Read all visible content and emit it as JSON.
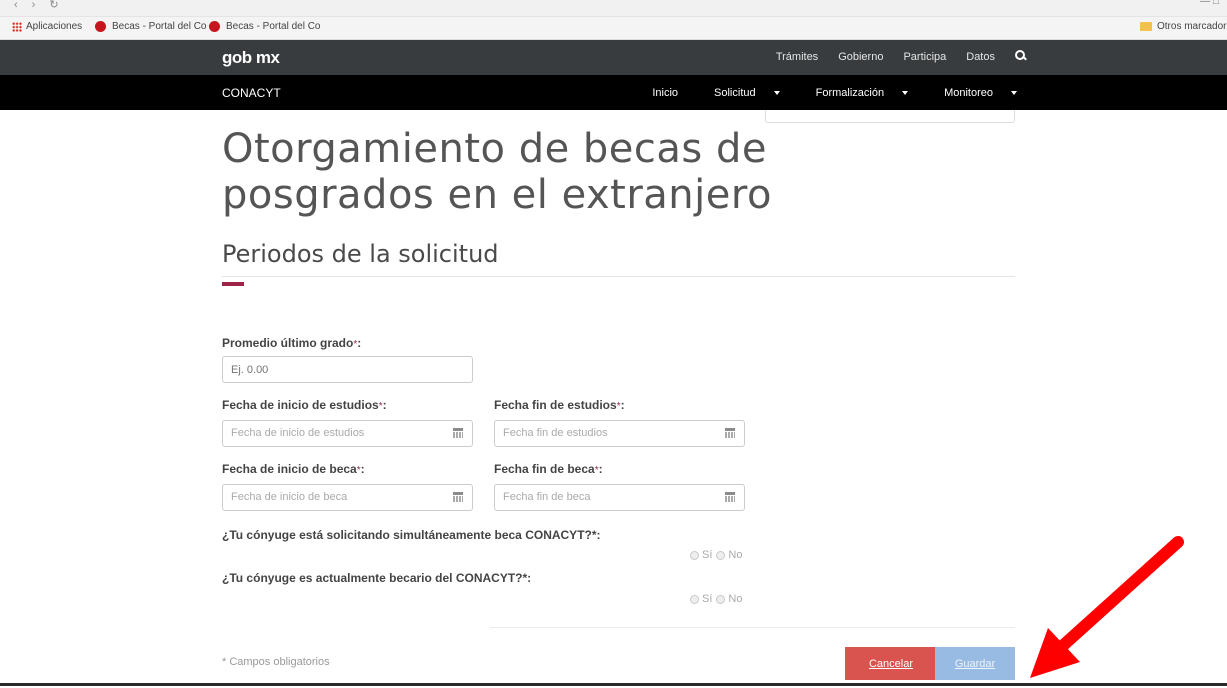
{
  "bookmarks": {
    "apps_label": "Aplicaciones",
    "items": [
      "Becas - Portal del Co",
      "Becas - Portal del Co"
    ],
    "other_label": "Otros marcadore"
  },
  "gob_header": {
    "logo": "gob mx",
    "links": [
      "Trámites",
      "Gobierno",
      "Participa",
      "Datos"
    ]
  },
  "conacyt_header": {
    "title": "CONACYT",
    "nav": [
      {
        "label": "Inicio",
        "dropdown": false
      },
      {
        "label": "Solicitud",
        "dropdown": true
      },
      {
        "label": "Formalización",
        "dropdown": true
      },
      {
        "label": "Monitoreo",
        "dropdown": true
      }
    ]
  },
  "page": {
    "title": "Otorgamiento de becas de posgrados en el extranjero",
    "section_title": "Periodos de la solicitud"
  },
  "form": {
    "required_marker": "*",
    "promedio": {
      "label": "Promedio último grado",
      "placeholder": "Ej. 0.00"
    },
    "fecha_inicio_estudios": {
      "label": "Fecha de inicio de estudios",
      "placeholder": "Fecha de inicio de estudios"
    },
    "fecha_fin_estudios": {
      "label": "Fecha fin de estudios",
      "placeholder": "Fecha fin de estudios"
    },
    "fecha_inicio_beca": {
      "label": "Fecha de inicio de beca",
      "placeholder": "Fecha de inicio de beca"
    },
    "fecha_fin_beca": {
      "label": "Fecha fin de beca",
      "placeholder": "Fecha fin de beca"
    },
    "q_conyuge_solicitando": {
      "label": "¿Tu cónyuge está solicitando simultáneamente beca CONACYT?*:",
      "yes": "Sí",
      "no": "No"
    },
    "q_conyuge_becario": {
      "label": "¿Tu cónyuge es actualmente becario del CONACYT?*:",
      "yes": "Sí",
      "no": "No"
    },
    "footnote": "* Campos obligatorios",
    "cancel_label": "Cancelar",
    "save_label": "Guardar"
  },
  "colors": {
    "accent": "#9d2449",
    "cancel": "#d9534f",
    "save": "#98bbe3",
    "annotation_arrow": "#ff0000"
  }
}
